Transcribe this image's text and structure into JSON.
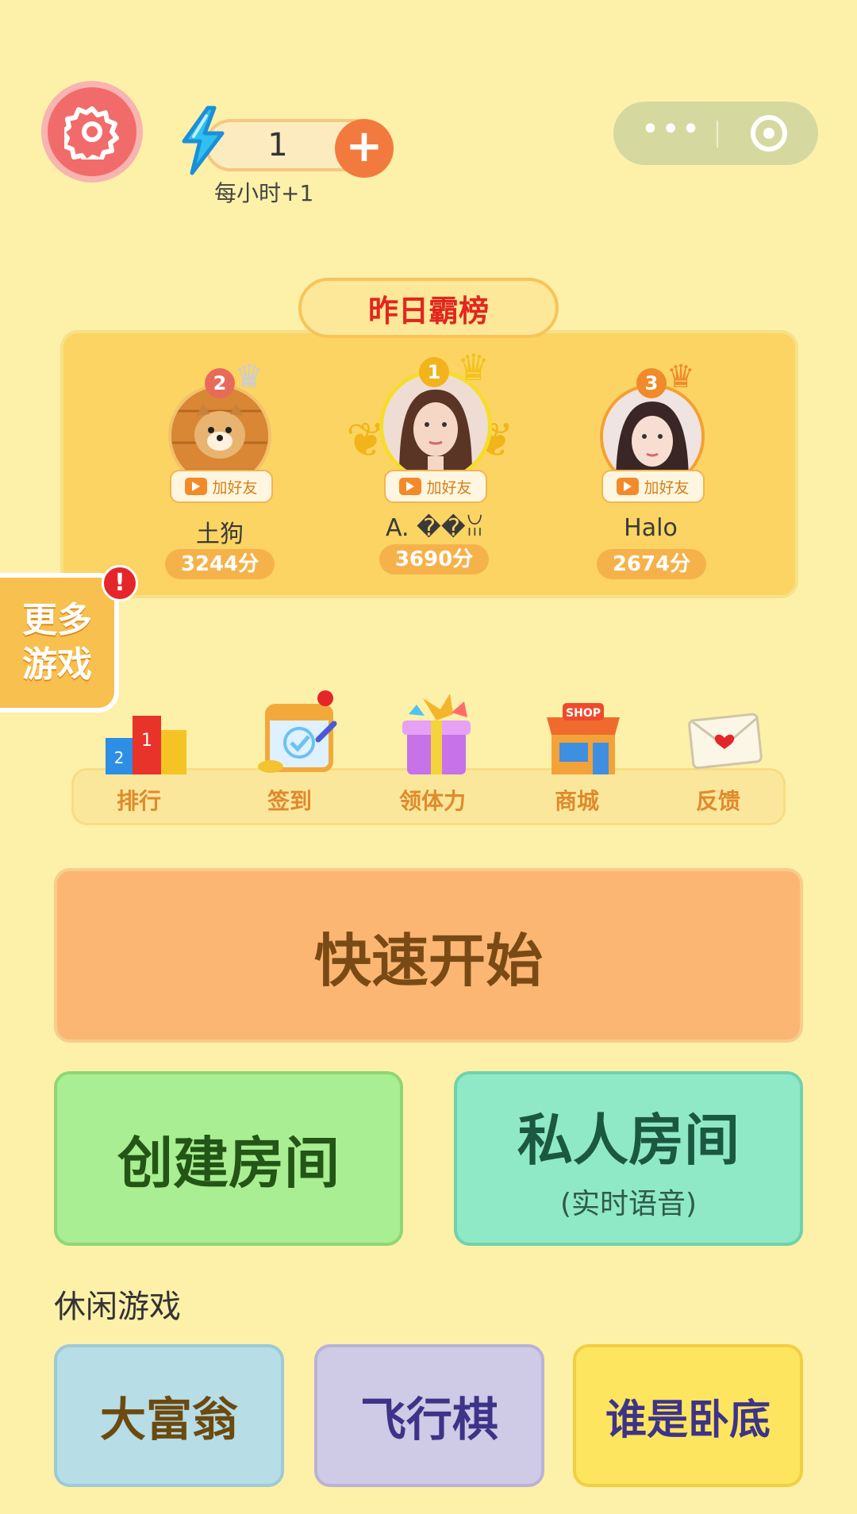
{
  "header": {
    "energy_value": "1",
    "energy_plus": "+",
    "energy_rate": "每小时+1",
    "capsule_more": "•••"
  },
  "leaderboard": {
    "title": "昨日霸榜",
    "add_friend_label": "加好友",
    "players": [
      {
        "rank": "2",
        "name": "土狗",
        "score": "3244分"
      },
      {
        "rank": "1",
        "name": "A. ��ꈍ",
        "score": "3690分"
      },
      {
        "rank": "3",
        "name": "Halo",
        "score": "2674分"
      }
    ]
  },
  "more_games": {
    "label_line1": "更多",
    "label_line2": "游戏",
    "alert": "!"
  },
  "menu": {
    "items": [
      {
        "label": "排行",
        "icon": "ranking-podium-icon"
      },
      {
        "label": "签到",
        "icon": "calendar-checkin-icon"
      },
      {
        "label": "领体力",
        "icon": "gift-box-icon"
      },
      {
        "label": "商城",
        "icon": "shop-icon"
      },
      {
        "label": "反馈",
        "icon": "envelope-icon"
      }
    ],
    "shop_sign": "SHOP"
  },
  "actions": {
    "quick_start": "快速开始",
    "create_room": "创建房间",
    "private_room": "私人房间",
    "private_room_sub": "(实时语音)"
  },
  "casual": {
    "title": "休闲游戏",
    "games": [
      "大富翁",
      "飞行棋",
      "谁是卧底"
    ]
  },
  "colors": {
    "background": "#fdf0a8",
    "accent_red": "#e2261f",
    "quick_start": "#fbb673",
    "create_room": "#a9ee92",
    "private_room": "#8fe9c7"
  }
}
